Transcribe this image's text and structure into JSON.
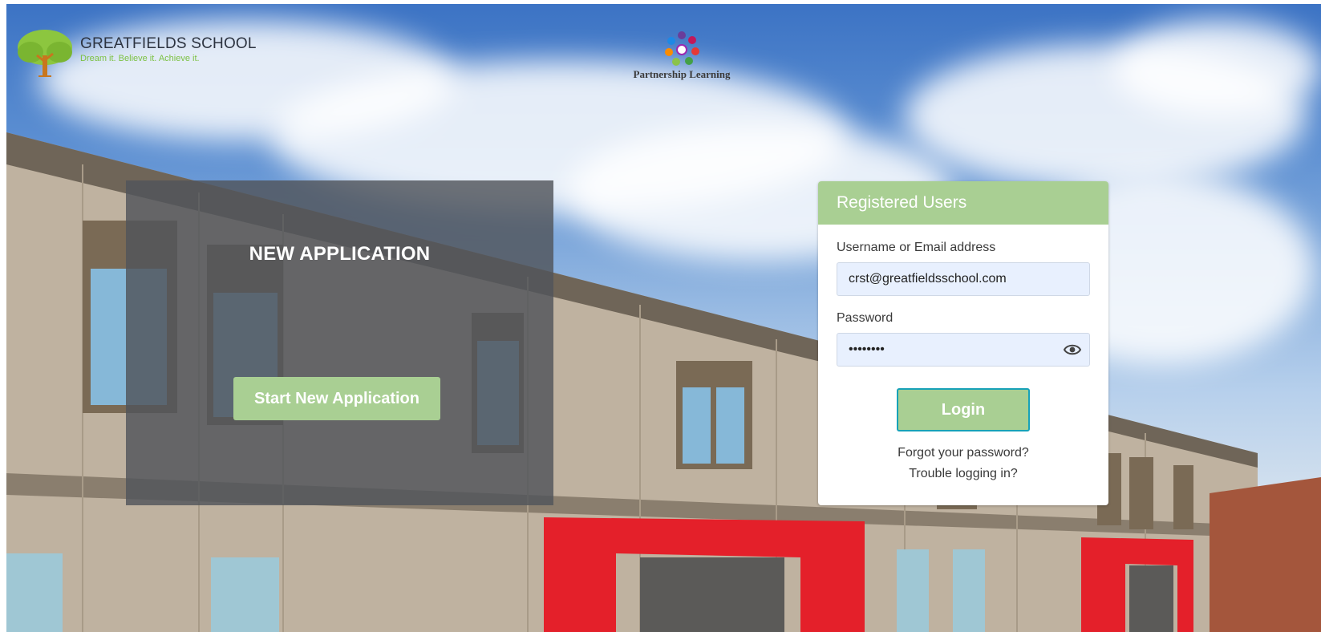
{
  "header": {
    "school_name": "GREATFIELDS SCHOOL",
    "school_tagline": "Dream it. Believe it. Achieve it.",
    "partner_name": "Partnership Learning"
  },
  "new_application": {
    "title": "NEW APPLICATION",
    "start_button_label": "Start New Application"
  },
  "login": {
    "header": "Registered Users",
    "username_label": "Username or Email address",
    "username_value": "crst@greatfieldsschool.com",
    "password_label": "Password",
    "password_value": "••••••••",
    "login_button_label": "Login",
    "forgot_password_link": "Forgot your password?",
    "trouble_link": "Trouble logging in?"
  },
  "colors": {
    "accent_green": "#a9cf93",
    "login_button_border": "#17a2b8",
    "tagline_green": "#7cc143",
    "input_background": "#e8f0fe"
  },
  "icons": {
    "school_logo": "tree-icon",
    "partner_logo": "people-circle-icon",
    "password_toggle": "eye-icon"
  }
}
